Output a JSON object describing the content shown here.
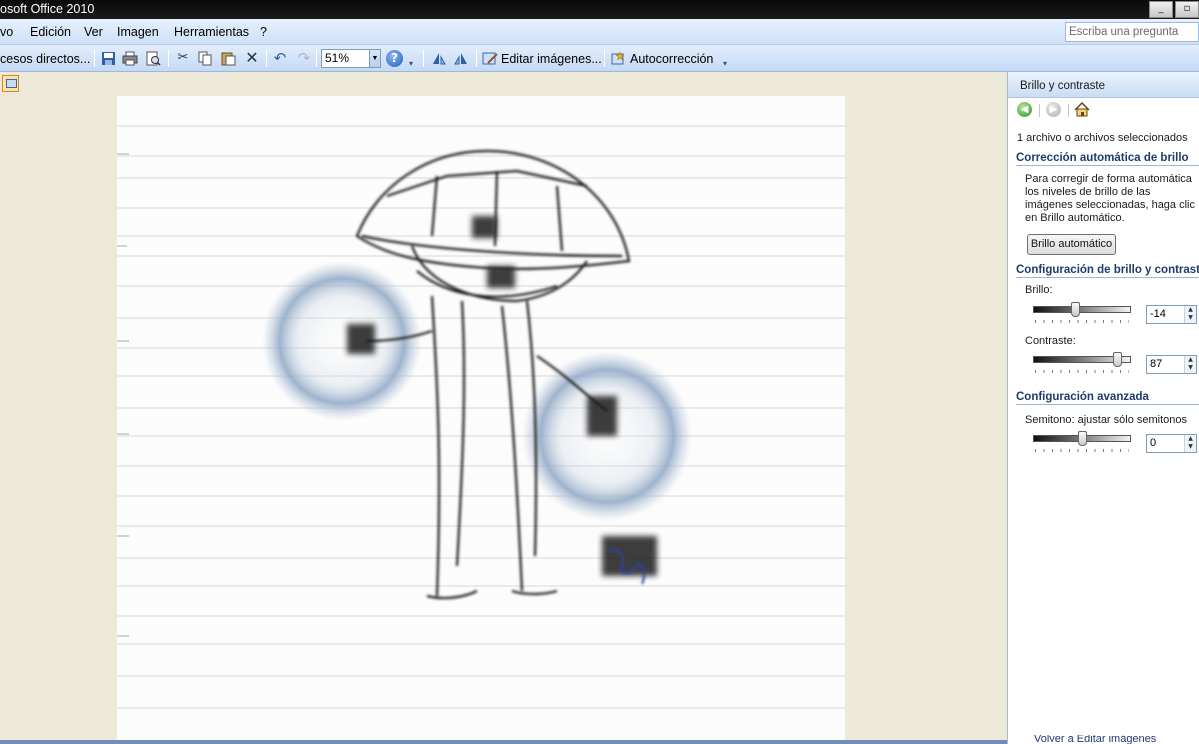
{
  "window": {
    "title": "osoft Office 2010",
    "buttons": [
      "_",
      "▫"
    ]
  },
  "menubar": {
    "items": [
      "vo",
      "Edición",
      "Ver",
      "Imagen",
      "Herramientas",
      "?"
    ],
    "ask_placeholder": "Escriba una pregunta"
  },
  "toolbar": {
    "shortcuts_label": "cesos directos...",
    "zoom": "51%",
    "edit_images_label": "Editar imágenes...",
    "autocorrect_label": "Autocorrección"
  },
  "pane": {
    "title": "Brillo y contraste",
    "selection_info": "1 archivo o archivos seleccionados",
    "auto_section": "Corrección automática de brillo",
    "auto_desc": "Para corregir de forma automática los niveles de brillo de las imágenes seleccionadas, haga clic en Brillo automático.",
    "auto_button": "Brillo automático",
    "config_section": "Configuración de brillo y contraste",
    "brightness_label": "Brillo:",
    "brightness_value": "-14",
    "brightness_level": 0.43,
    "contrast_label": "Contraste:",
    "contrast_value": "87",
    "contrast_level": 0.9,
    "advanced_section": "Configuración avanzada",
    "midtone_label": "Semitono: ajustar sólo semitonos",
    "midtone_value": "0",
    "midtone_level": 0.5,
    "bottom_link": "Volver a Editar imágenes"
  },
  "colors": {
    "titlebar": "#0a0a0a",
    "menubar": "#d7e6fa",
    "section_text": "#1f3b6b",
    "canvas_bg": "#ece9d8"
  }
}
